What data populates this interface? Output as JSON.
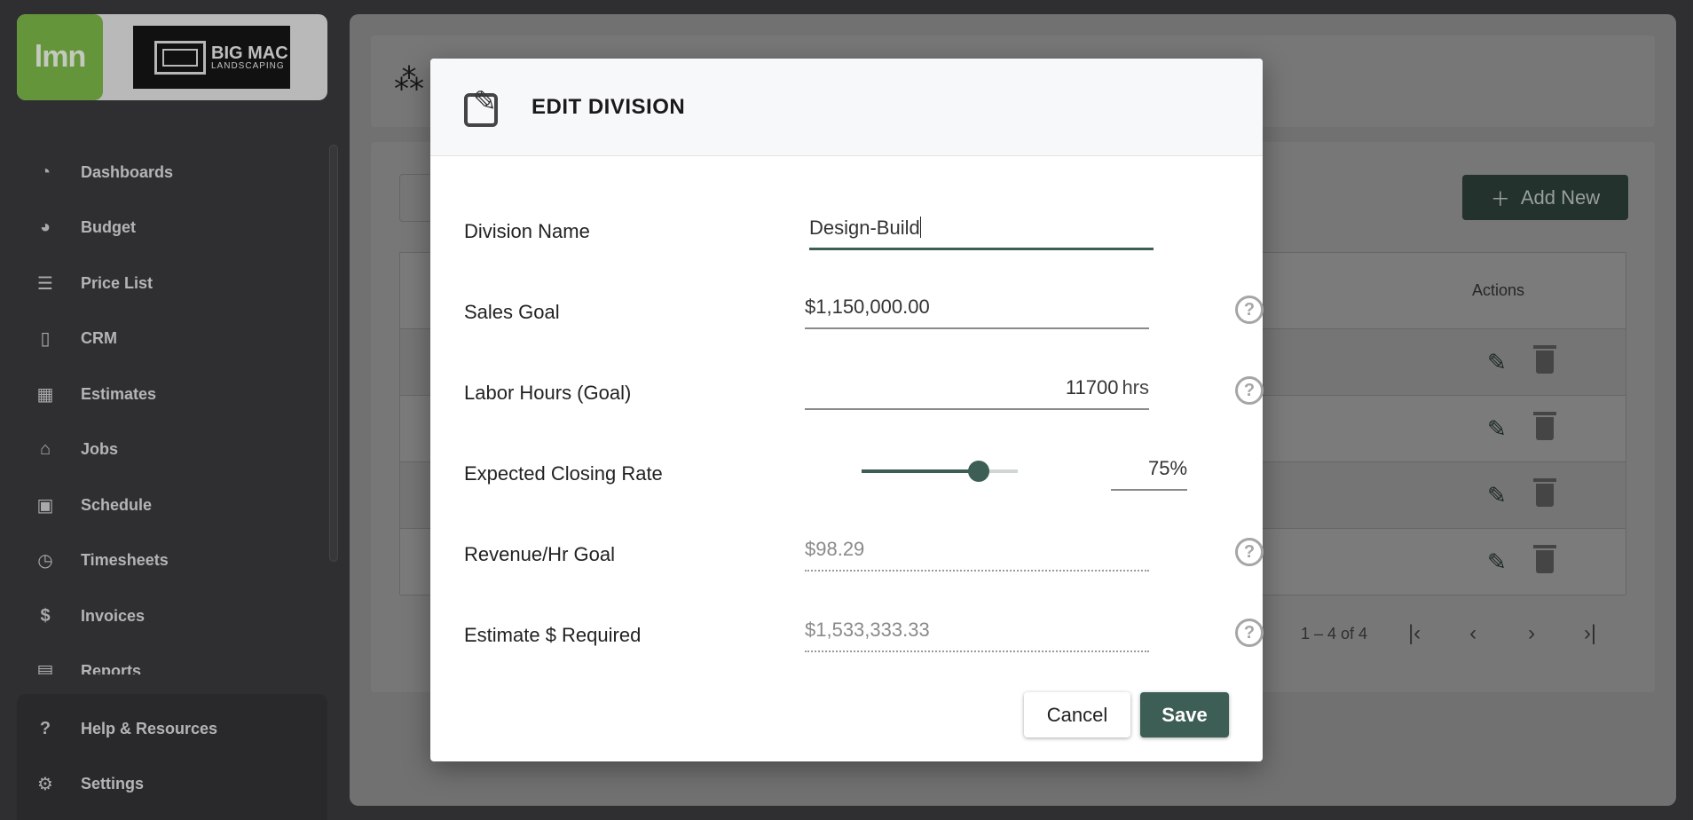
{
  "sidebar": {
    "brand_lmn": "lmn",
    "brand_big": "BIG MAC",
    "brand_landscaping": "LANDSCAPING",
    "items": [
      {
        "label": "Dashboards",
        "icon": "dashboard-icon"
      },
      {
        "label": "Budget",
        "icon": "pie-chart-icon"
      },
      {
        "label": "Price List",
        "icon": "list-icon"
      },
      {
        "label": "CRM",
        "icon": "contact-card-icon"
      },
      {
        "label": "Estimates",
        "icon": "calculator-icon"
      },
      {
        "label": "Jobs",
        "icon": "garage-icon"
      },
      {
        "label": "Schedule",
        "icon": "calendar-icon"
      },
      {
        "label": "Timesheets",
        "icon": "clock-icon"
      },
      {
        "label": "Invoices",
        "icon": "invoice-icon"
      },
      {
        "label": "Reports",
        "icon": "report-icon"
      }
    ],
    "bottom_items": [
      {
        "label": "Help & Resources",
        "icon": "help-chat-icon"
      },
      {
        "label": "Settings",
        "icon": "gear-icon"
      }
    ]
  },
  "main": {
    "add_new_label": "Add New",
    "actions_header": "Actions",
    "pagination": "1 – 4 of 4"
  },
  "dialog": {
    "title": "EDIT DIVISION",
    "division_name": {
      "label": "Division Name",
      "value": "Design-Build"
    },
    "sales_goal": {
      "label": "Sales Goal",
      "value": "$1,150,000.00"
    },
    "labor_hours": {
      "label": "Labor Hours (Goal)",
      "value": "11700",
      "unit": "hrs"
    },
    "closing_rate": {
      "label": "Expected Closing Rate",
      "value": "75",
      "unit": "%",
      "fraction": 0.75
    },
    "revenue_hr": {
      "label": "Revenue/Hr Goal",
      "value": "$98.29"
    },
    "estimate_required": {
      "label": "Estimate $ Required",
      "value": "$1,533,333.33"
    },
    "cancel_label": "Cancel",
    "save_label": "Save"
  },
  "colors": {
    "accent": "#3d5e54",
    "lmn_green": "#7ab648"
  }
}
